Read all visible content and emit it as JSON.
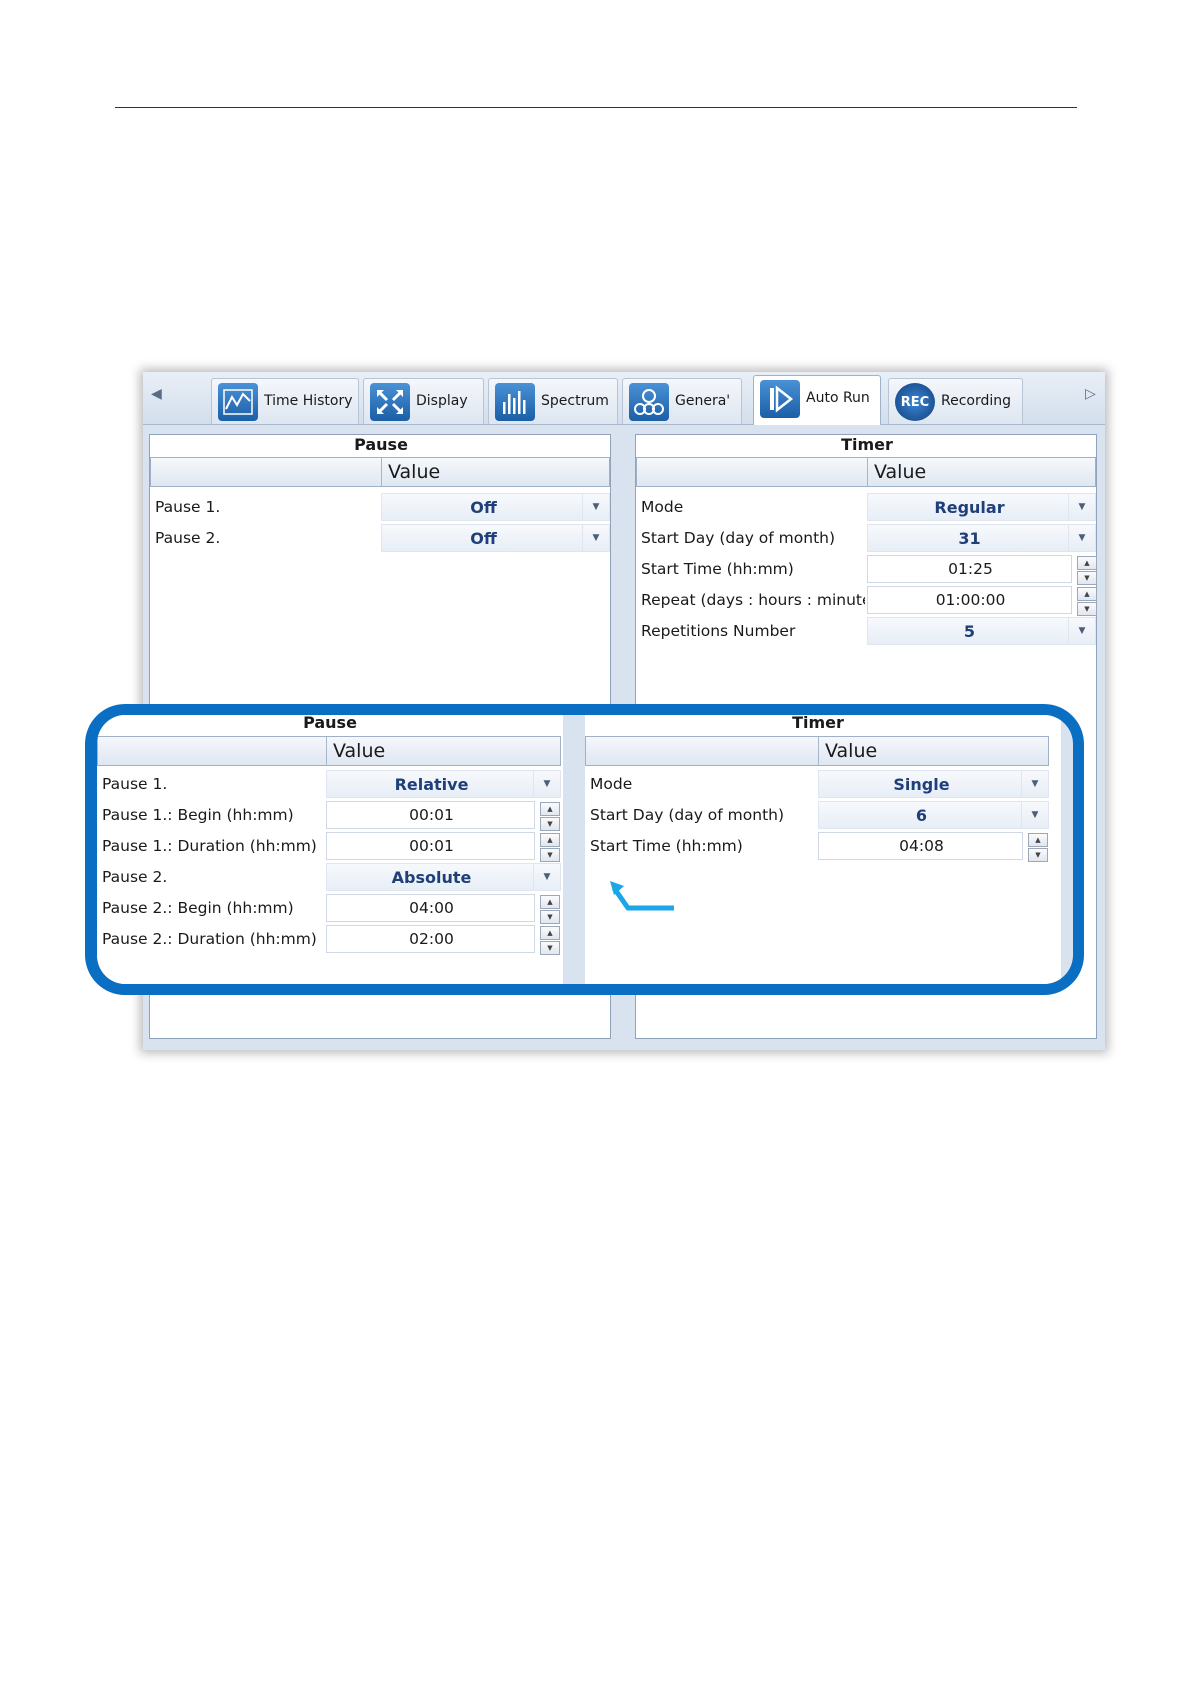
{
  "tabbar": {
    "tabs": [
      {
        "label": "Time History",
        "icon": "line-chart-icon"
      },
      {
        "label": "Display",
        "icon": "expand-arrows-icon"
      },
      {
        "label": "Spectrum",
        "icon": "bar-spectrum-icon"
      },
      {
        "label": "Genera'",
        "icon": "gears-icon"
      },
      {
        "label": "Auto Run",
        "icon": "play-icon"
      },
      {
        "label": "Recording",
        "icon": "rec-icon"
      }
    ],
    "active_tab": "Auto Run",
    "rec_badge": "REC"
  },
  "main": {
    "pause": {
      "title": "Pause",
      "value_header": "Value",
      "rows": [
        {
          "label": "Pause 1.",
          "value": "Off"
        },
        {
          "label": "Pause 2.",
          "value": "Off"
        }
      ]
    },
    "timer": {
      "title": "Timer",
      "value_header": "Value",
      "rows": [
        {
          "label": "Mode",
          "value": "Regular"
        },
        {
          "label": "Start Day (day of month)",
          "value": "31"
        },
        {
          "label": "Start Time (hh:mm)",
          "value": "01:25"
        },
        {
          "label": "Repeat (days : hours : minute",
          "value": "01:00:00"
        },
        {
          "label": "Repetitions Number",
          "value": "5"
        }
      ]
    }
  },
  "overlay": {
    "pause": {
      "title": "Pause",
      "value_header": "Value",
      "rows": [
        {
          "label": "Pause 1.",
          "value": "Relative"
        },
        {
          "label": "Pause 1.: Begin (hh:mm)",
          "value": "00:01"
        },
        {
          "label": "Pause 1.: Duration (hh:mm)",
          "value": "00:01"
        },
        {
          "label": "Pause 2.",
          "value": "Absolute"
        },
        {
          "label": "Pause 2.: Begin (hh:mm)",
          "value": "04:00"
        },
        {
          "label": "Pause 2.: Duration (hh:mm)",
          "value": "02:00"
        }
      ]
    },
    "timer": {
      "title": "Timer",
      "value_header": "Value",
      "rows": [
        {
          "label": "Mode",
          "value": "Single"
        },
        {
          "label": "Start Day (day of month)",
          "value": "6"
        },
        {
          "label": "Start Time (hh:mm)",
          "value": "04:08"
        }
      ]
    }
  },
  "colors": {
    "accent_border": "#0a6fc2",
    "callout_arrow": "#1ba6e8",
    "value_text": "#1f3f7a"
  }
}
